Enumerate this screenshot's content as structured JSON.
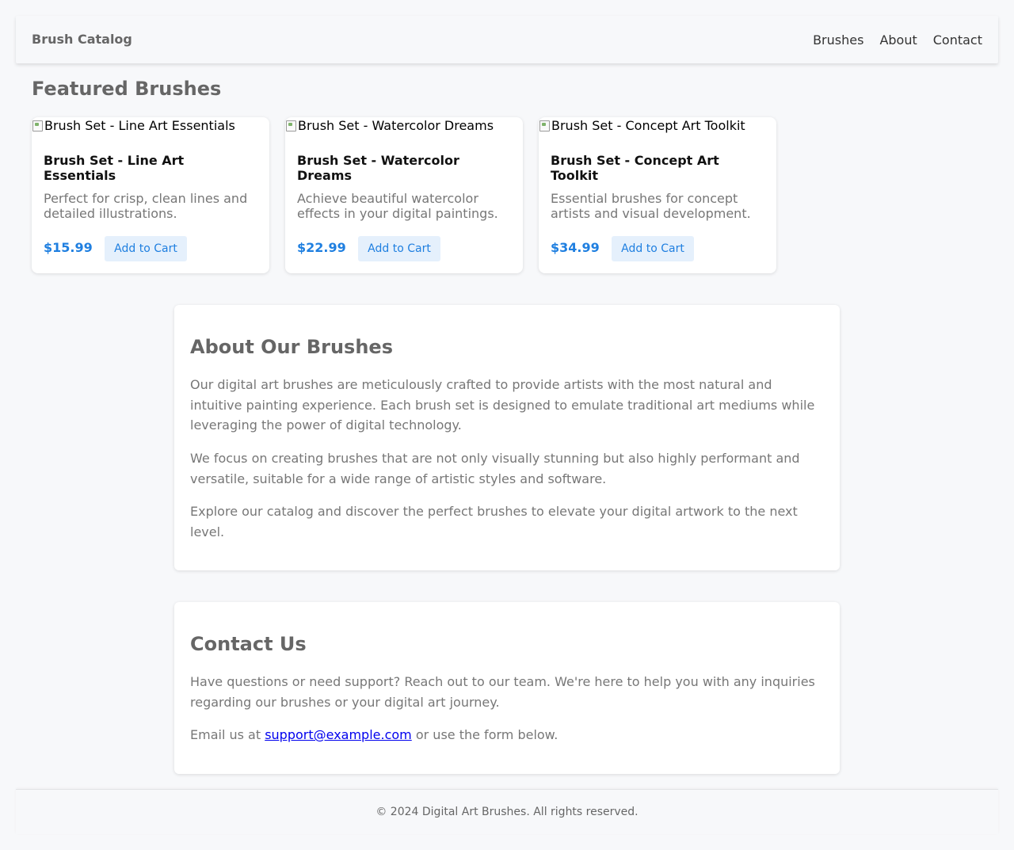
{
  "header": {
    "brand": "Brush Catalog",
    "nav": [
      {
        "label": "Brushes"
      },
      {
        "label": "About"
      },
      {
        "label": "Contact"
      }
    ]
  },
  "featured": {
    "title": "Featured Brushes",
    "cards": [
      {
        "image_alt": "Brush Set - Line Art Essentials",
        "title": "Brush Set - Line Art Essentials",
        "description": "Perfect for crisp, clean lines and detailed illustrations.",
        "price": "$15.99",
        "button": "Add to Cart"
      },
      {
        "image_alt": "Brush Set - Watercolor Dreams",
        "title": "Brush Set - Watercolor Dreams",
        "description": "Achieve beautiful watercolor effects in your digital paintings.",
        "price": "$22.99",
        "button": "Add to Cart"
      },
      {
        "image_alt": "Brush Set - Concept Art Toolkit",
        "title": "Brush Set - Concept Art Toolkit",
        "description": "Essential brushes for concept artists and visual development.",
        "price": "$34.99",
        "button": "Add to Cart"
      }
    ]
  },
  "about": {
    "title": "About Our Brushes",
    "paragraphs": [
      "Our digital art brushes are meticulously crafted to provide artists with the most natural and intuitive painting experience. Each brush set is designed to emulate traditional art mediums while leveraging the power of digital technology.",
      "We focus on creating brushes that are not only visually stunning but also highly performant and versatile, suitable for a wide range of artistic styles and software.",
      "Explore our catalog and discover the perfect brushes to elevate your digital artwork to the next level."
    ]
  },
  "contact": {
    "title": "Contact Us",
    "paragraph": "Have questions or need support? Reach out to our team. We're here to help you with any inquiries regarding our brushes or your digital art journey.",
    "email_prefix": "Email us at ",
    "email": "support@example.com",
    "email_suffix": " or use the form below."
  },
  "footer": {
    "text": "© 2024 Digital Art Brushes. All rights reserved."
  },
  "colors": {
    "accent": "#1f7fe0",
    "button_bg": "#e5f0fc",
    "link": "#0000ee",
    "page_bg": "#f7f8fa"
  }
}
